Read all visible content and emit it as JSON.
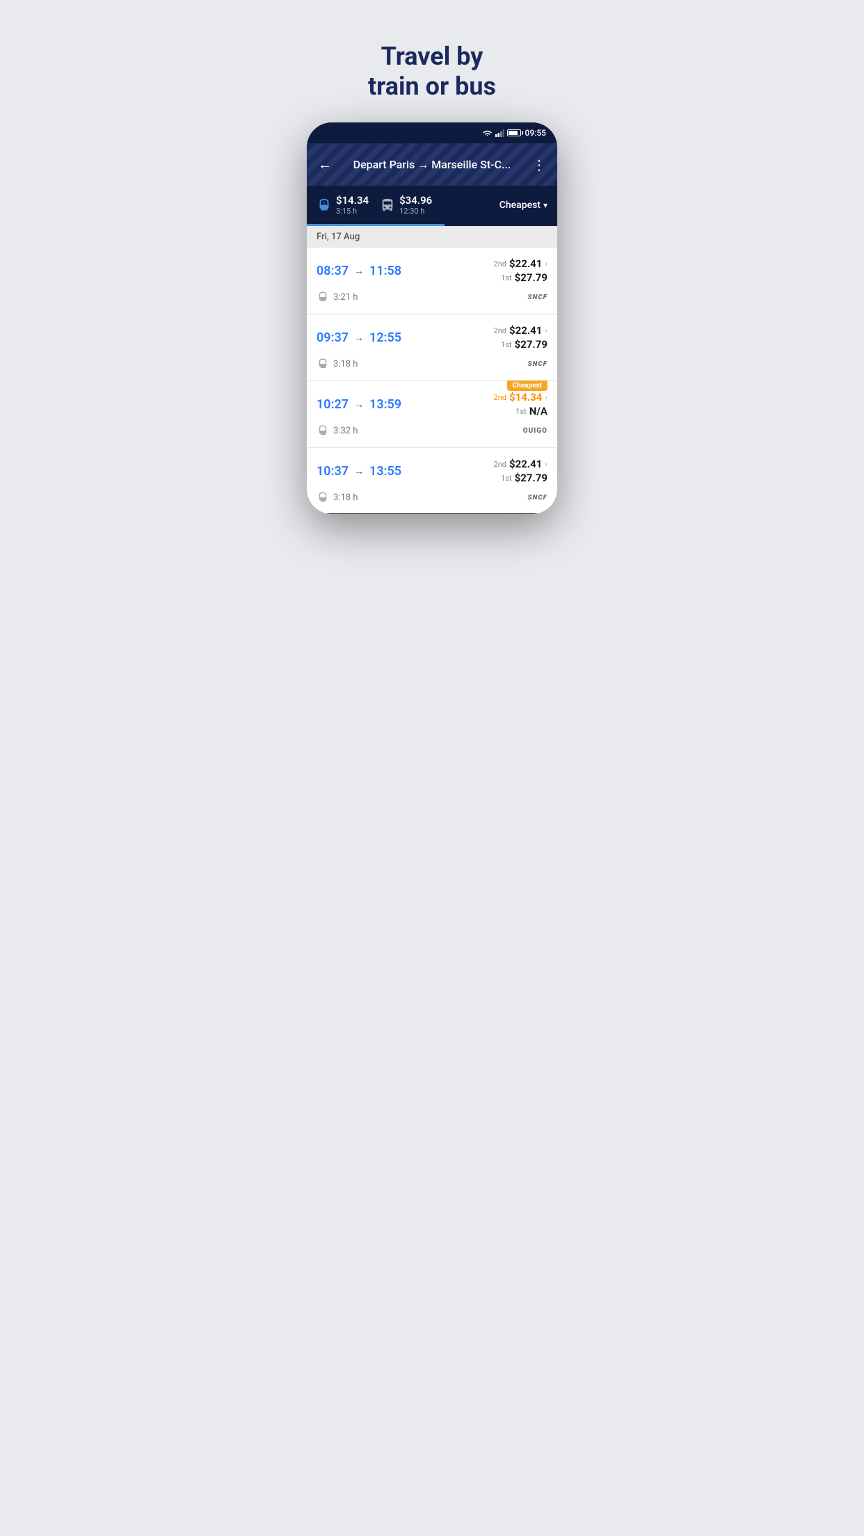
{
  "hero": {
    "line1": "Travel by",
    "line2": "train or bus"
  },
  "status_bar": {
    "time": "09:55"
  },
  "header": {
    "route": "Depart Paris → Marseille St-C...",
    "back_label": "←",
    "more_label": "⋮"
  },
  "filter_bar": {
    "train_price": "$14.34",
    "train_duration": "3:15 h",
    "bus_price": "$34.96",
    "bus_duration": "12:30 h",
    "sort_label": "Cheapest"
  },
  "date_header": "Fri, 17 Aug",
  "results": [
    {
      "depart": "08:37",
      "arrive": "11:58",
      "duration": "3:21 h",
      "class2_label": "2nd",
      "class2_price": "$22.41",
      "class1_label": "1st",
      "class1_price": "$27.79",
      "operator": "SNCF",
      "cheapest": false
    },
    {
      "depart": "09:37",
      "arrive": "12:55",
      "duration": "3:18 h",
      "class2_label": "2nd",
      "class2_price": "$22.41",
      "class1_label": "1st",
      "class1_price": "$27.79",
      "operator": "SNCF",
      "cheapest": false
    },
    {
      "depart": "10:27",
      "arrive": "13:59",
      "duration": "3:32 h",
      "class2_label": "2nd",
      "class2_price": "$14.34",
      "class1_label": "1st",
      "class1_price": "N/A",
      "operator": "OUIGO",
      "cheapest": true
    },
    {
      "depart": "10:37",
      "arrive": "13:55",
      "duration": "3:18 h",
      "class2_label": "2nd",
      "class2_price": "$22.41",
      "class1_label": "1st",
      "class1_price": "$27.79",
      "operator": "SNCF",
      "cheapest": false
    }
  ]
}
